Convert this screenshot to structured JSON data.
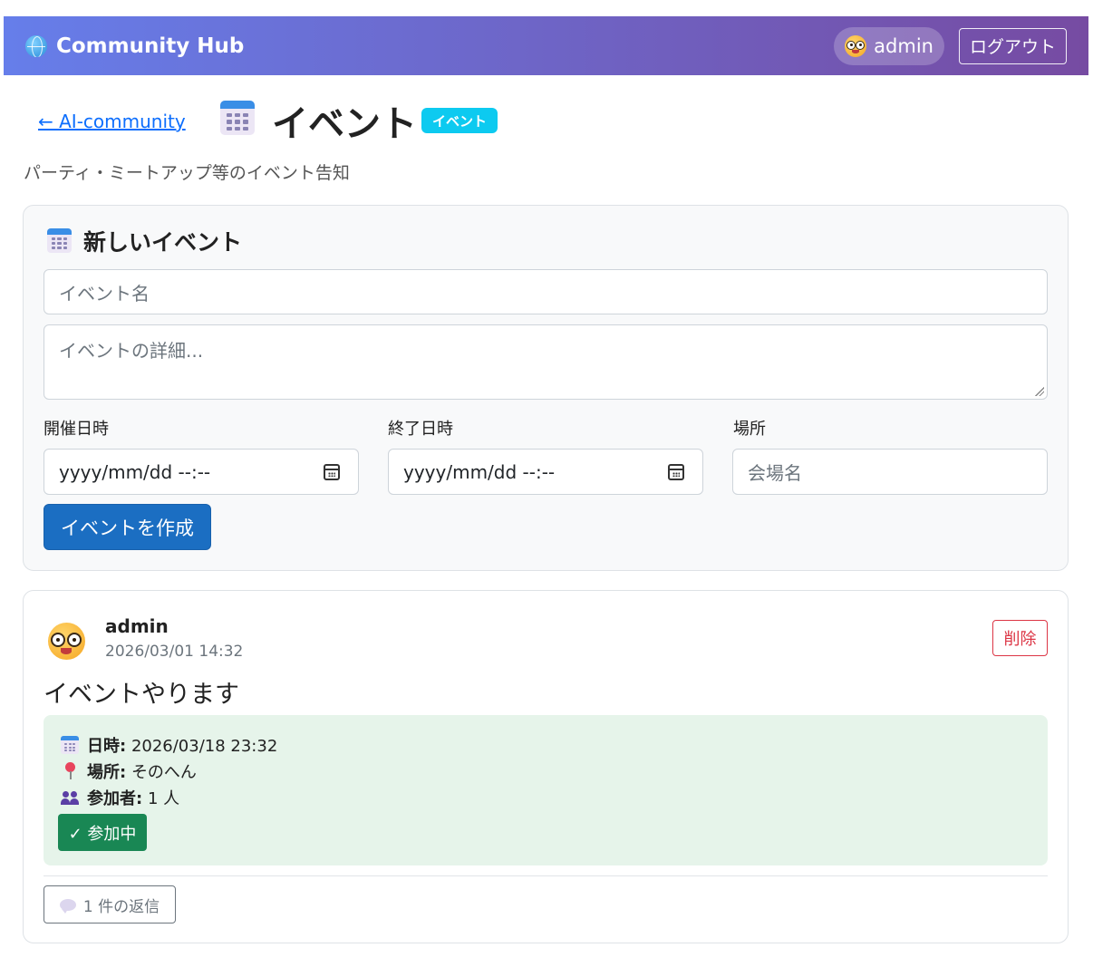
{
  "navbar": {
    "brand": "Community Hub",
    "user": "admin",
    "logout": "ログアウト"
  },
  "header": {
    "back_link": "← AI-community",
    "title": "イベント",
    "badge": "イベント",
    "subtitle": "パーティ・ミートアップ等のイベント告知"
  },
  "form": {
    "title": "新しいイベント",
    "name_placeholder": "イベント名",
    "details_placeholder": "イベントの詳細...",
    "start_label": "開催日時",
    "start_value": "yyyy/mm/dd --:--",
    "end_label": "終了日時",
    "end_value": "yyyy/mm/dd --:--",
    "place_label": "場所",
    "place_placeholder": "会場名",
    "submit": "イベントを作成"
  },
  "post": {
    "author": "admin",
    "timestamp": "2026/03/01 14:32",
    "delete": "削除",
    "title": "イベントやります",
    "datetime_label": "日時:",
    "datetime_value": "2026/03/18 23:32",
    "place_label": "場所:",
    "place_value": "そのへん",
    "participants_label": "参加者:",
    "participants_value": "1 人",
    "joining": "✓ 参加中",
    "replies": "1 件の返信"
  },
  "colors": {
    "navbar_start": "#667eea",
    "navbar_end": "#764ba2",
    "primary": "#1b6ec2",
    "badge": "#0dcaf0",
    "success": "#198754",
    "danger": "#dc3545",
    "event_box": "#e6f4ea"
  }
}
